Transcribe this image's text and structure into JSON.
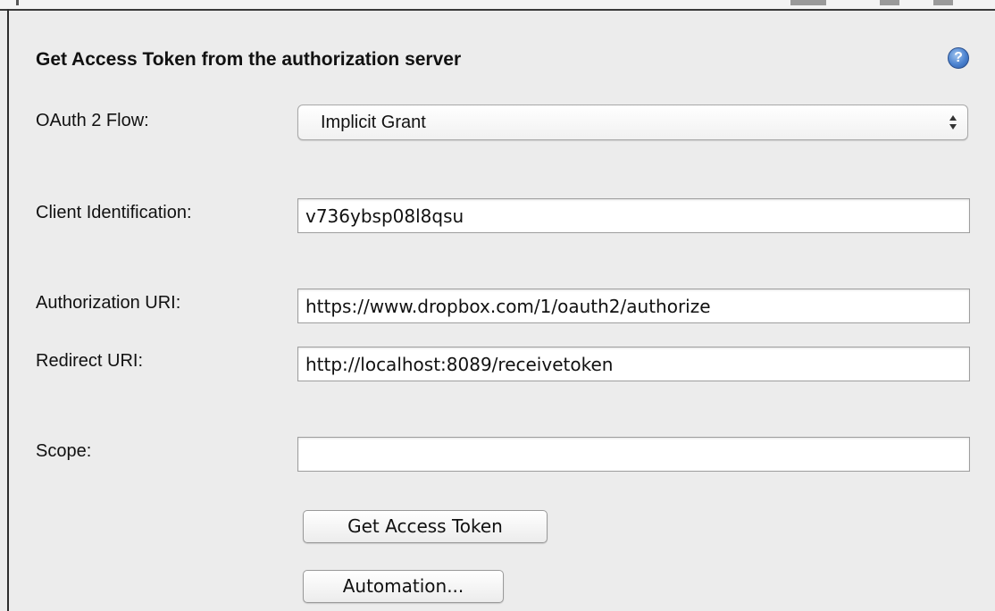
{
  "panel": {
    "title": "Get Access Token from the authorization server",
    "help_icon": "question-mark-help-icon",
    "help_glyph": "?"
  },
  "oauth_flow": {
    "label": "OAuth 2 Flow:",
    "selected": "Implicit Grant"
  },
  "client_identification": {
    "label": "Client Identification:",
    "value": "v736ybsp08l8qsu"
  },
  "authorization_uri": {
    "label": "Authorization URI:",
    "value": "https://www.dropbox.com/1/oauth2/authorize"
  },
  "redirect_uri": {
    "label": "Redirect URI:",
    "value": "http://localhost:8089/receivetoken"
  },
  "scope": {
    "label": "Scope:",
    "value": ""
  },
  "buttons": {
    "get_access_token": "Get Access Token",
    "automation": "Automation..."
  },
  "colors": {
    "panel_background": "#ececec",
    "help_icon_blue": "#4b82cf"
  }
}
